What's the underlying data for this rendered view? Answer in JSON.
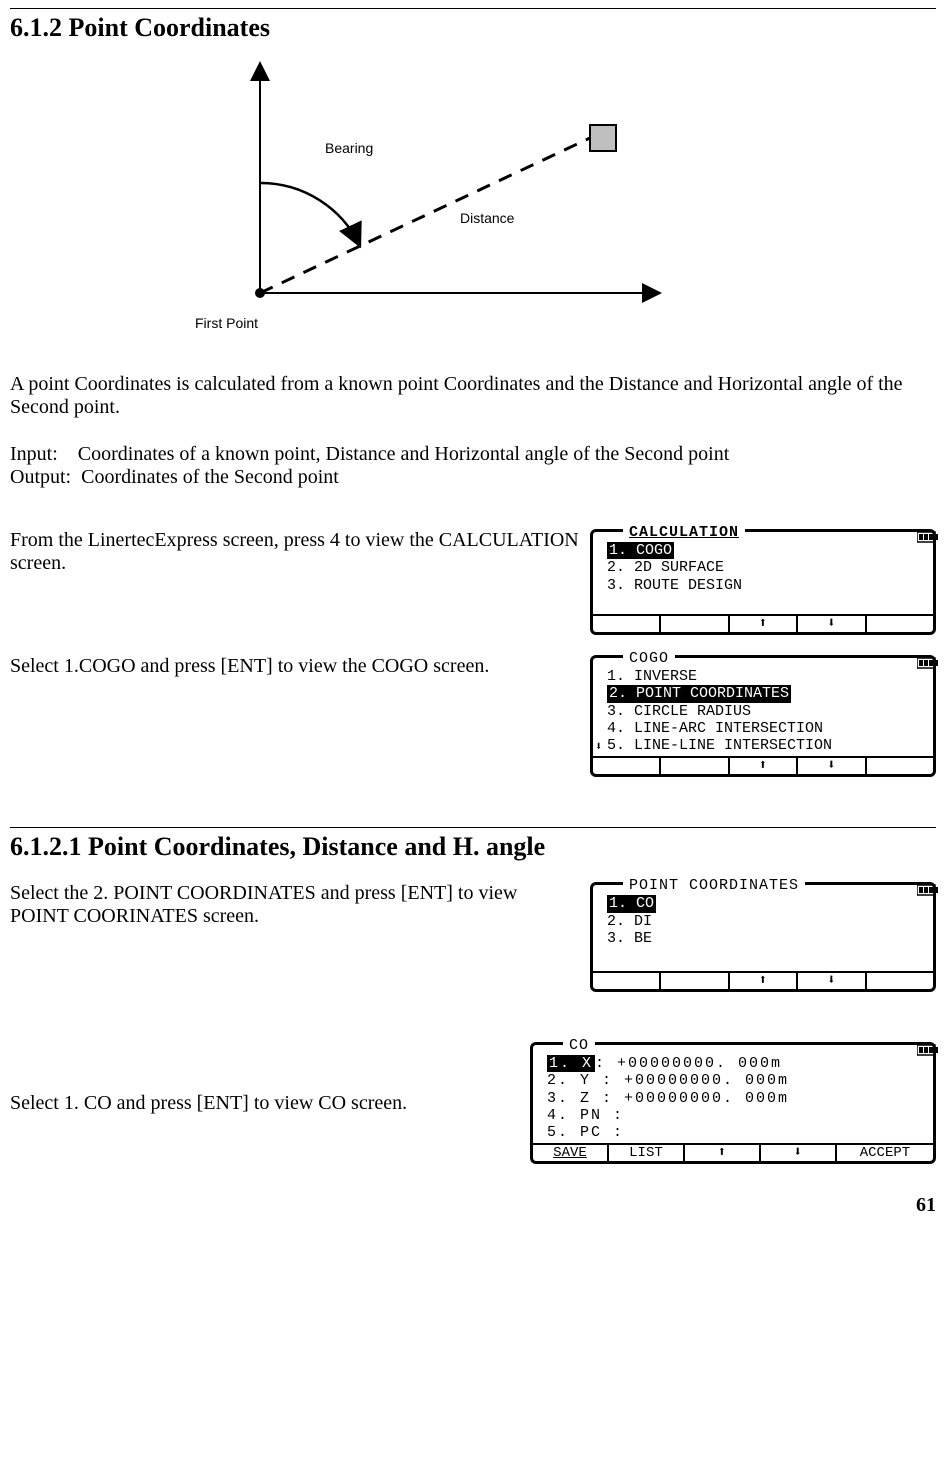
{
  "section1": {
    "number": "6.1.2",
    "title": "Point Coordinates"
  },
  "diagram": {
    "bearing": "Bearing",
    "distance": "Distance",
    "first_point": "First Point"
  },
  "desc": "A point Coordinates is calculated from a known point Coordinates and the Distance and Horizontal angle of the Second point.",
  "io": {
    "input_l": "Input:",
    "input_v": "Coordinates of a known point, Distance and Horizontal angle of the Second point",
    "output_l": "Output:",
    "output_v": "Coordinates of the Second point"
  },
  "step1": {
    "text": "From the LinertecExpress screen, press 4 to view the CALCULATION screen.",
    "screen": {
      "title": "CALCULATION",
      "items": [
        "1. COGO",
        "2. 2D SURFACE",
        "3. ROUTE DESIGN"
      ],
      "selected": 0,
      "up": "⬆",
      "down": "⬇"
    }
  },
  "step2": {
    "text": "Select 1.COGO and press [ENT] to view the COGO screen.",
    "screen": {
      "title": "COGO",
      "items": [
        "1. INVERSE",
        "2. POINT COORDINATES",
        "3. CIRCLE RADIUS",
        "4. LINE-ARC INTERSECTION",
        "5. LINE-LINE INTERSECTION"
      ],
      "selected": 1,
      "guide": "⬇",
      "up": "⬆",
      "down": "⬇"
    }
  },
  "section2": {
    "number": "6.1.2.1",
    "title": "Point Coordinates, Distance and H. angle"
  },
  "step3": {
    "text": "Select the 2. POINT COORDINATES and press [ENT] to view POINT COORINATES screen.",
    "screen": {
      "title": "POINT COORDINATES",
      "items": [
        "1. CO",
        "2. DI",
        "3. BE"
      ],
      "selected": 0,
      "up": "⬆",
      "down": "⬇"
    }
  },
  "step4": {
    "text": "Select 1. CO and press [ENT] to view CO screen.",
    "screen": {
      "title": "CO",
      "btn_save": "SAVE",
      "btn_list": "LIST",
      "btn_accept": "ACCEPT",
      "up": "⬆",
      "down": "⬇",
      "r1_l": "1. X",
      "r1_v": ": +00000000. 000m",
      "r2": "2. Y : +00000000. 000m",
      "r3": "3. Z : +00000000. 000m",
      "r4": "4. PN :",
      "r5": "5. PC :"
    }
  },
  "page": "61"
}
